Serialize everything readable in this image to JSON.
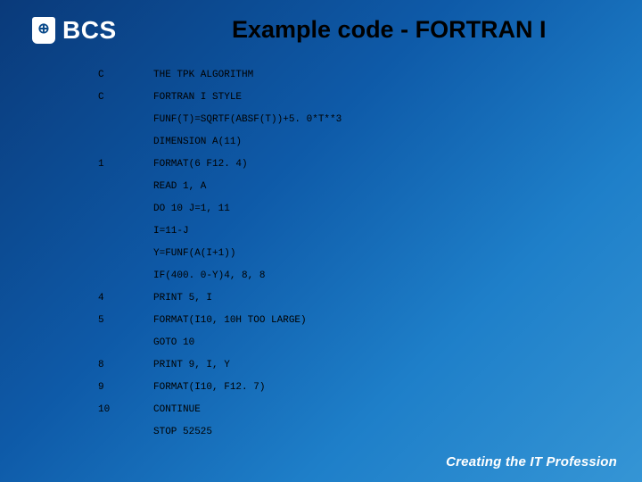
{
  "logo": {
    "badge": "⊕",
    "text": "BCS"
  },
  "title": "Example code - FORTRAN I",
  "code": {
    "lines": [
      {
        "label": "C",
        "stmt": "THE TPK ALGORITHM"
      },
      {
        "label": "C",
        "stmt": "FORTRAN I STYLE"
      },
      {
        "label": "",
        "stmt": "FUNF(T)=SQRTF(ABSF(T))+5. 0*T**3"
      },
      {
        "label": "",
        "stmt": "DIMENSION A(11)"
      },
      {
        "label": "1",
        "stmt": "FORMAT(6 F12. 4)"
      },
      {
        "label": "",
        "stmt": "READ 1, A"
      },
      {
        "label": "",
        "stmt": "DO 10 J=1, 11"
      },
      {
        "label": "",
        "stmt": "I=11-J"
      },
      {
        "label": "",
        "stmt": "Y=FUNF(A(I+1))"
      },
      {
        "label": "",
        "stmt": "IF(400. 0-Y)4, 8, 8"
      },
      {
        "label": "4",
        "stmt": "PRINT 5, I"
      },
      {
        "label": "5",
        "stmt": "FORMAT(I10, 10H TOO LARGE)"
      },
      {
        "label": "",
        "stmt": "GOTO 10"
      },
      {
        "label": "8",
        "stmt": "PRINT 9, I, Y"
      },
      {
        "label": "9",
        "stmt": "FORMAT(I10, F12. 7)"
      },
      {
        "label": "10",
        "stmt": "CONTINUE"
      },
      {
        "label": "",
        "stmt": "STOP 52525"
      }
    ]
  },
  "footer": {
    "prefix": "Creating the ",
    "bold": "IT",
    "suffix": " Profession"
  }
}
